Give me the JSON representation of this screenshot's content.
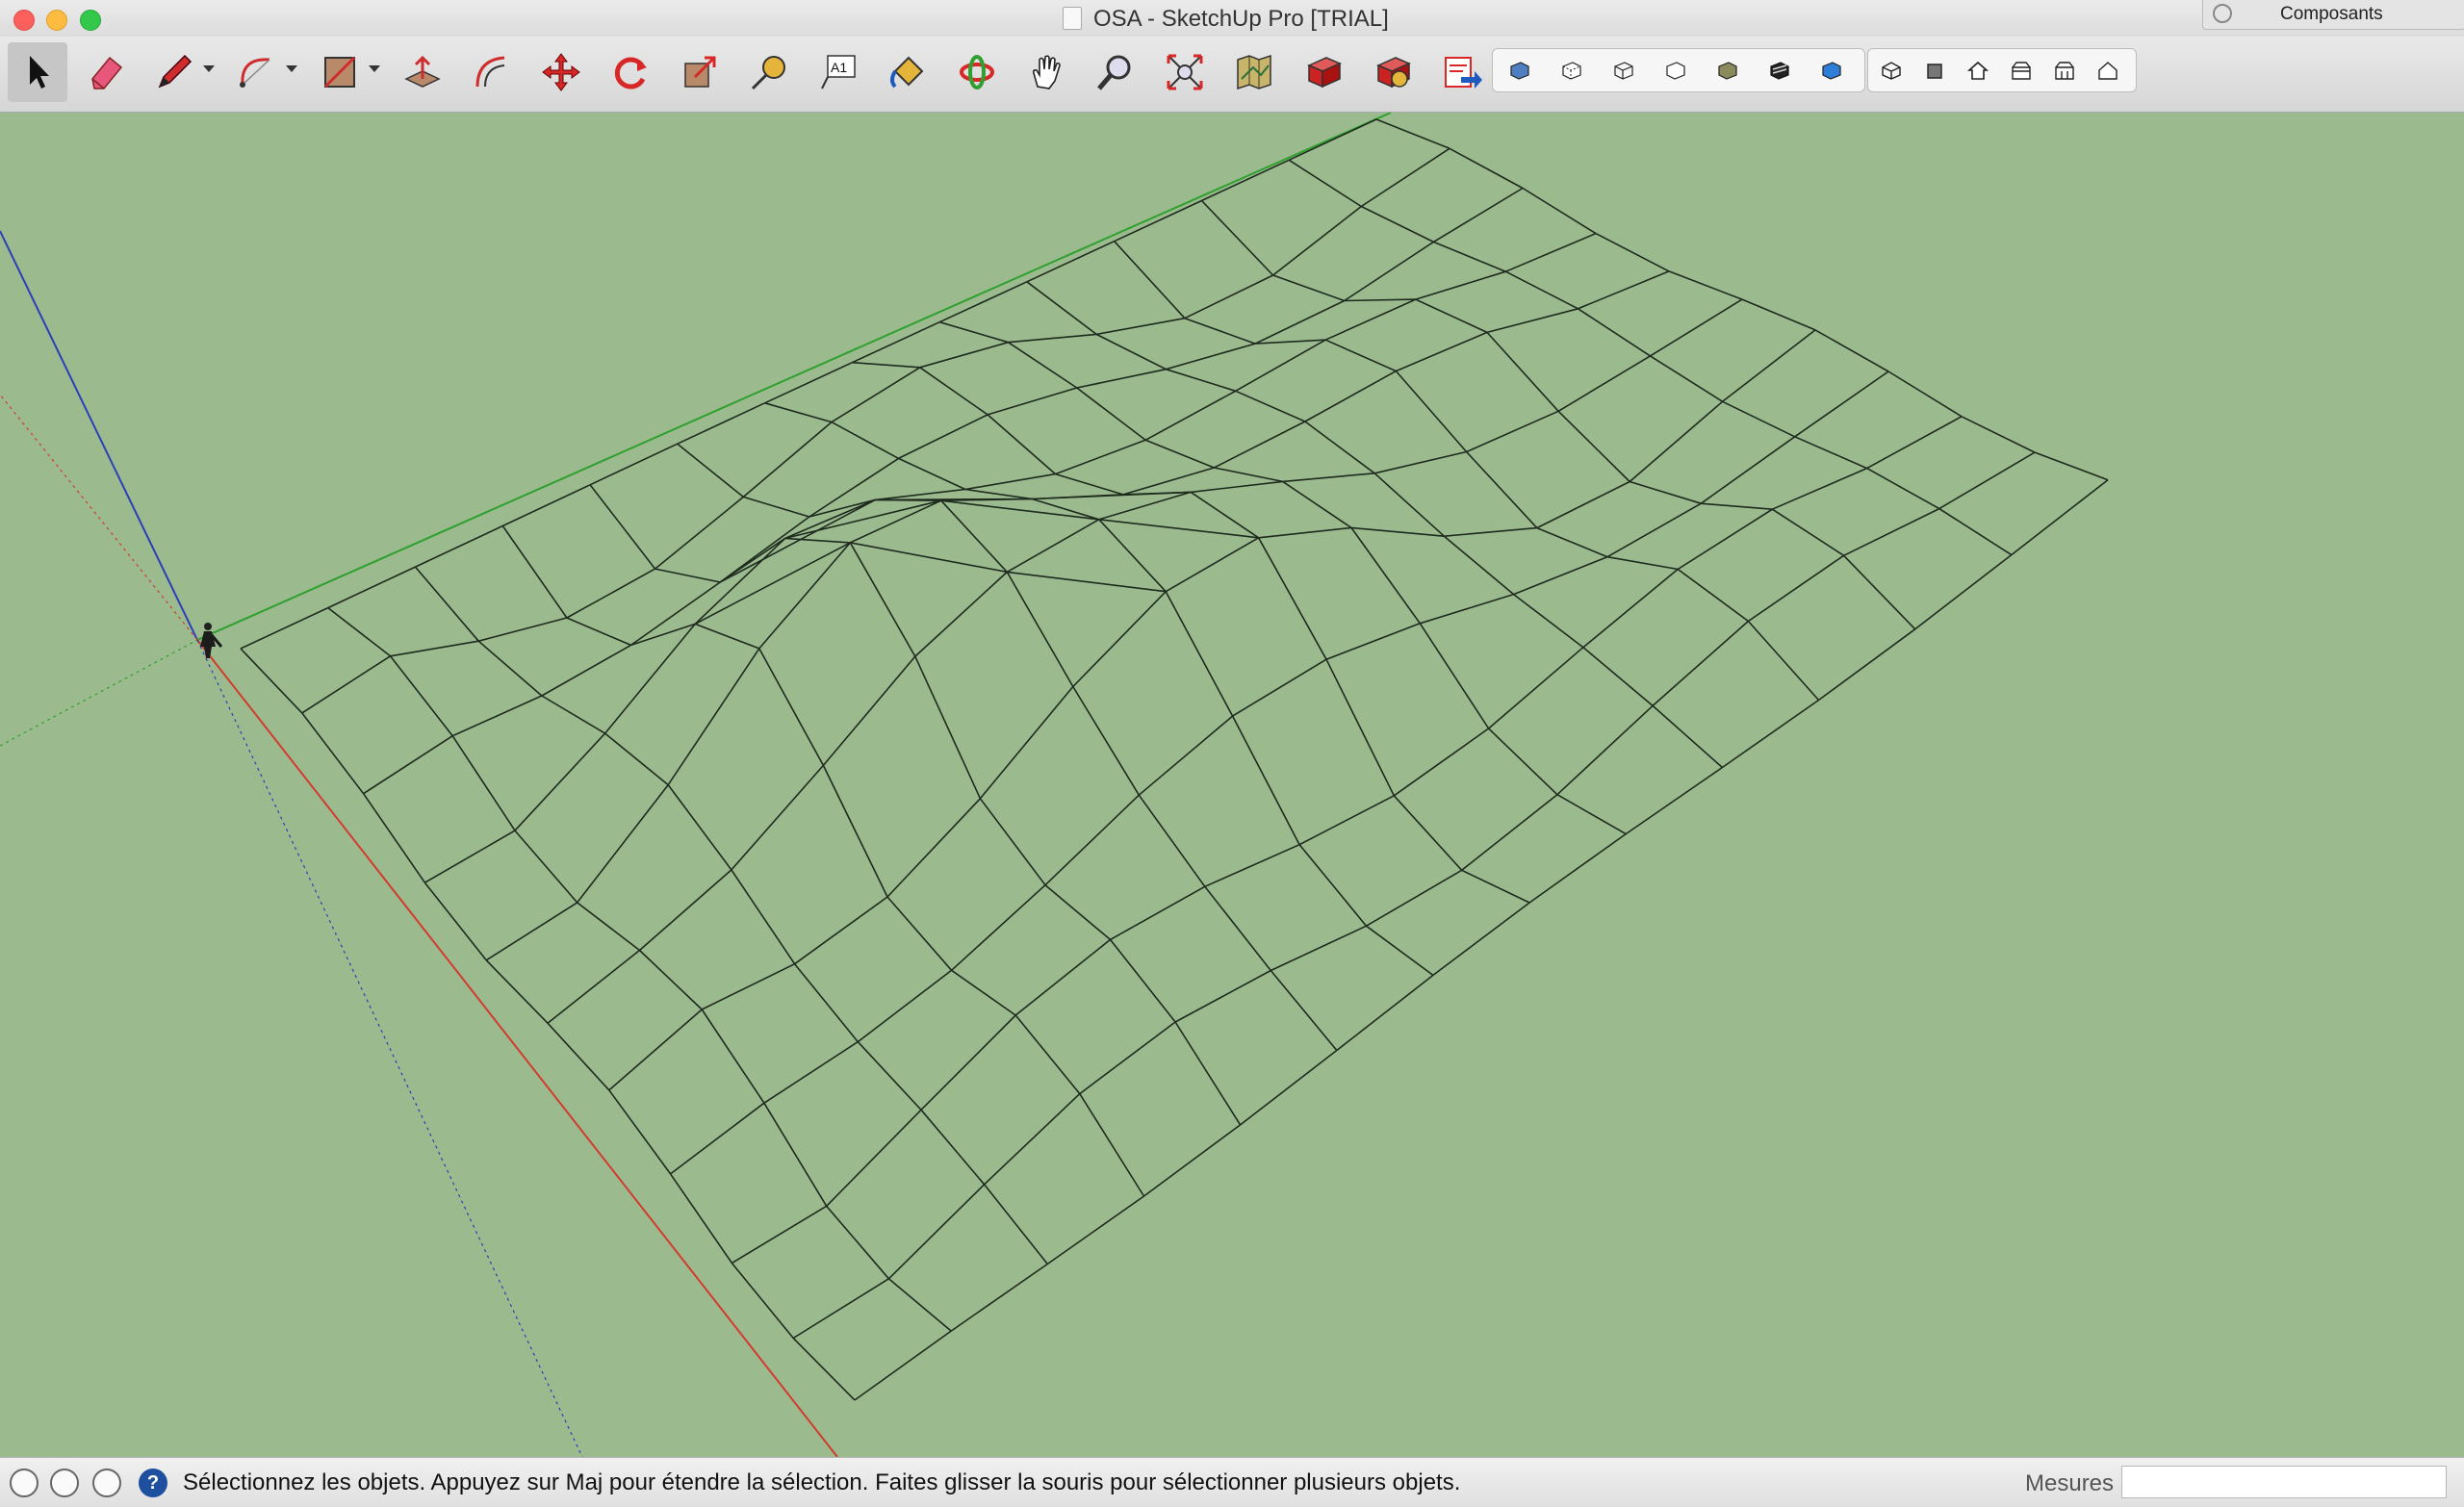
{
  "window": {
    "title": "OSA - SketchUp Pro [TRIAL]",
    "panel_label": "Composants"
  },
  "toolbar": {
    "tools": [
      {
        "id": "select",
        "icon": "select-arrow-icon"
      },
      {
        "id": "eraser",
        "icon": "eraser-icon"
      },
      {
        "id": "line",
        "icon": "pencil-icon",
        "dropdown": true
      },
      {
        "id": "arc",
        "icon": "arc-icon",
        "dropdown": true
      },
      {
        "id": "rectangle",
        "icon": "rectangle-icon",
        "dropdown": true
      },
      {
        "id": "push-pull",
        "icon": "push-pull-icon"
      },
      {
        "id": "offset",
        "icon": "offset-icon"
      },
      {
        "id": "move",
        "icon": "move-icon"
      },
      {
        "id": "rotate",
        "icon": "rotate-icon"
      },
      {
        "id": "scale",
        "icon": "scale-icon"
      },
      {
        "id": "tape-measure",
        "icon": "tape-measure-icon"
      },
      {
        "id": "text",
        "icon": "text-icon",
        "label": "A1"
      },
      {
        "id": "paint-bucket",
        "icon": "paint-bucket-icon"
      },
      {
        "id": "orbit",
        "icon": "orbit-icon"
      },
      {
        "id": "pan",
        "icon": "pan-hand-icon"
      },
      {
        "id": "zoom",
        "icon": "zoom-icon"
      },
      {
        "id": "zoom-extents",
        "icon": "zoom-extents-icon"
      },
      {
        "id": "add-location",
        "icon": "add-location-icon"
      },
      {
        "id": "warehouse",
        "icon": "3d-warehouse-icon"
      },
      {
        "id": "extension-warehouse",
        "icon": "extension-warehouse-icon"
      },
      {
        "id": "send-to-layout",
        "icon": "send-to-layout-icon"
      }
    ],
    "styles_group": [
      "x-ray-style-icon",
      "back-edges-style-icon",
      "wireframe-style-icon",
      "hidden-line-style-icon",
      "shaded-style-icon",
      "shaded-textures-style-icon",
      "monochrome-style-icon"
    ],
    "views_group": [
      "iso-view-icon",
      "top-view-icon",
      "front-view-icon",
      "right-view-icon",
      "back-view-icon",
      "left-view-icon"
    ]
  },
  "status": {
    "message": "Sélectionnez les objets. Appuyez sur Maj pour étendre la sélection. Faites glisser la souris pour sélectionner plusieurs objets.",
    "help_symbol": "?",
    "measurements_label": "Mesures",
    "measurements_value": ""
  },
  "colors": {
    "viewport": "#9bbb8e",
    "axis_red": "#d23b2e",
    "axis_green": "#2fa02f",
    "axis_blue": "#2a3fb8",
    "mesh": "#1e2a1e"
  }
}
